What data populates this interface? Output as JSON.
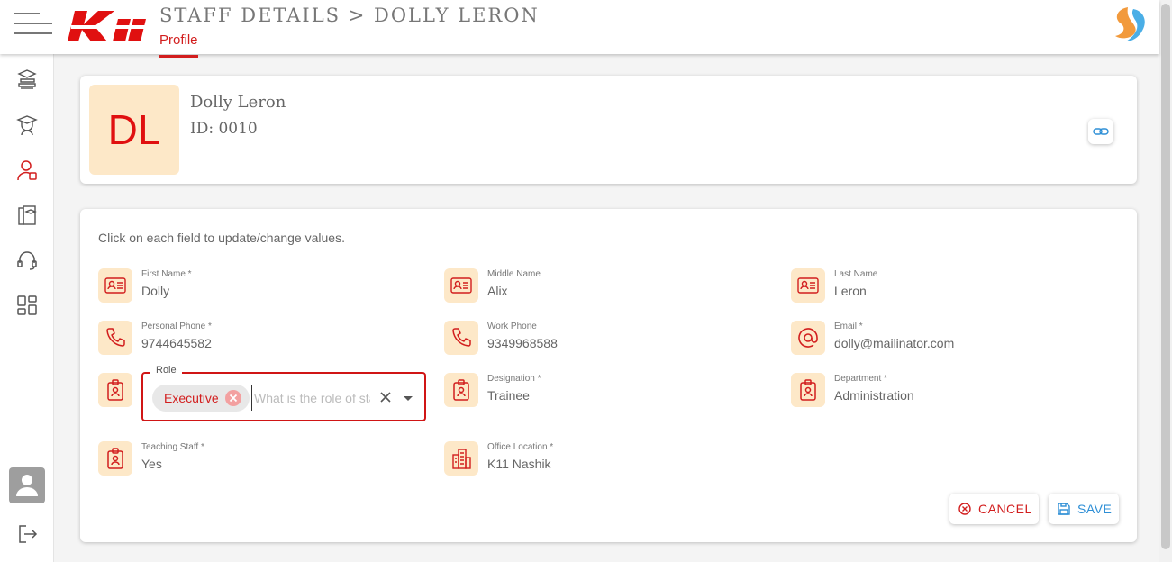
{
  "header": {
    "title": "STAFF DETAILS > DOLLY LERON",
    "active_tab": "Profile",
    "logo_text": "Kii"
  },
  "sidebar": {
    "items": [
      {
        "name": "courses",
        "icon": "book-stack-icon"
      },
      {
        "name": "students",
        "icon": "graduate-icon"
      },
      {
        "name": "staff",
        "icon": "staff-icon",
        "active": true
      },
      {
        "name": "library",
        "icon": "books-icon"
      },
      {
        "name": "support",
        "icon": "headset-icon"
      },
      {
        "name": "dashboard",
        "icon": "grid-icon"
      }
    ],
    "bottom": [
      "user-avatar",
      "logout-icon"
    ]
  },
  "profile": {
    "initials": "DL",
    "name": "Dolly Leron",
    "id_text": "ID: 0010"
  },
  "form": {
    "hint": "Click on each field to update/change values.",
    "fields": {
      "first_name": {
        "label": "First Name *",
        "value": "Dolly"
      },
      "middle_name": {
        "label": "Middle Name",
        "value": "Alix"
      },
      "last_name": {
        "label": "Last Name",
        "value": "Leron"
      },
      "personal_phone": {
        "label": "Personal Phone *",
        "value": "9744645582"
      },
      "work_phone": {
        "label": "Work Phone",
        "value": "9349968588"
      },
      "email": {
        "label": "Email *",
        "value": "dolly@mailinator.com"
      },
      "designation": {
        "label": "Designation *",
        "value": "Trainee"
      },
      "department": {
        "label": "Department *",
        "value": "Administration"
      },
      "teaching_staff": {
        "label": "Teaching Staff *",
        "value": "Yes"
      },
      "office_location": {
        "label": "Office Location *",
        "value": "K11 Nashik"
      }
    },
    "role": {
      "label": "Role",
      "selected": "Executive",
      "placeholder": "What is the role of staff?"
    },
    "cancel_label": "CANCEL",
    "save_label": "SAVE"
  },
  "colors": {
    "accent": "#d21e1e",
    "icon_bg": "#fde8c8",
    "save_blue": "#2e8fd6"
  }
}
